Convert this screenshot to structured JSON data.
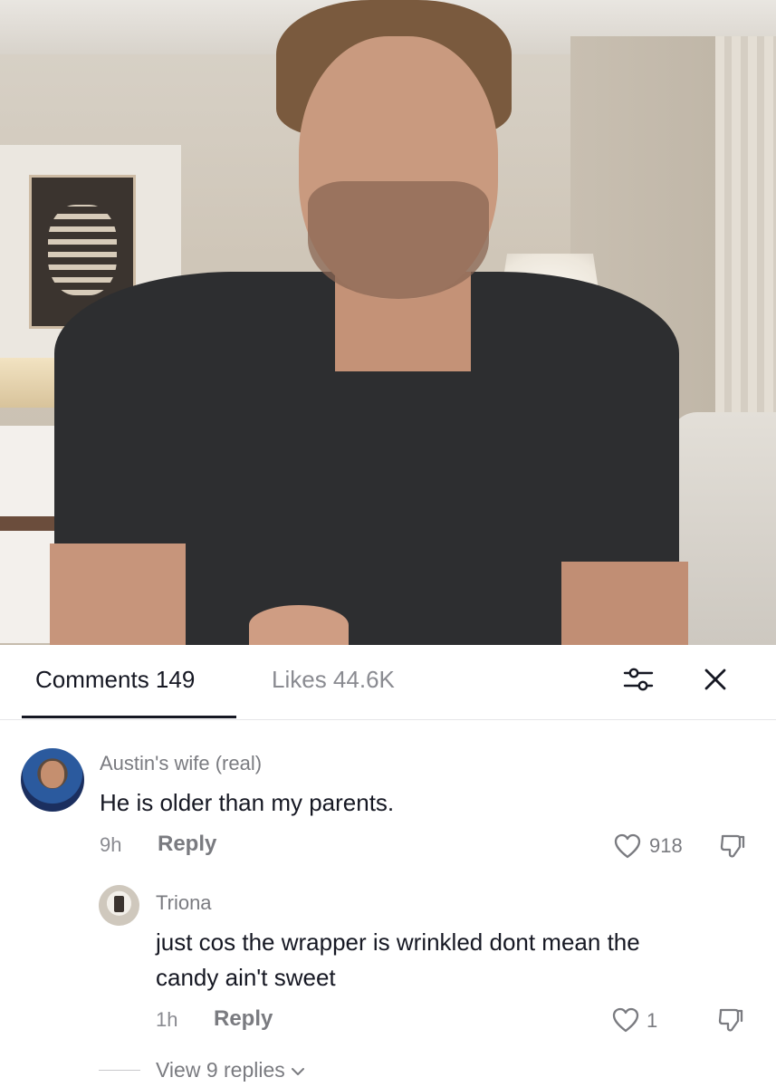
{
  "tabs": {
    "comments_label": "Comments 149",
    "likes_label": "Likes 44.6K"
  },
  "icons": {
    "filter": "sliders-icon",
    "close": "close-icon",
    "like": "heart-icon",
    "dislike": "thumbs-down-icon",
    "expand": "chevron-down-icon"
  },
  "comments": [
    {
      "username": "Austin's wife (real)",
      "text": "He is older than my parents.",
      "time": "9h",
      "reply_label": "Reply",
      "likes": "918",
      "replies": [
        {
          "username": "Triona",
          "text_line1": "just cos the wrapper is wrinkled dont mean the",
          "text_line2": "candy ain't sweet",
          "time": "1h",
          "reply_label": "Reply",
          "likes": "1"
        }
      ],
      "view_replies_label": "View 9 replies"
    }
  ],
  "colors": {
    "text_primary": "#161823",
    "text_secondary": "#7a7b80",
    "divider": "#e6e6e8",
    "sheet_bg": "#ffffff"
  }
}
